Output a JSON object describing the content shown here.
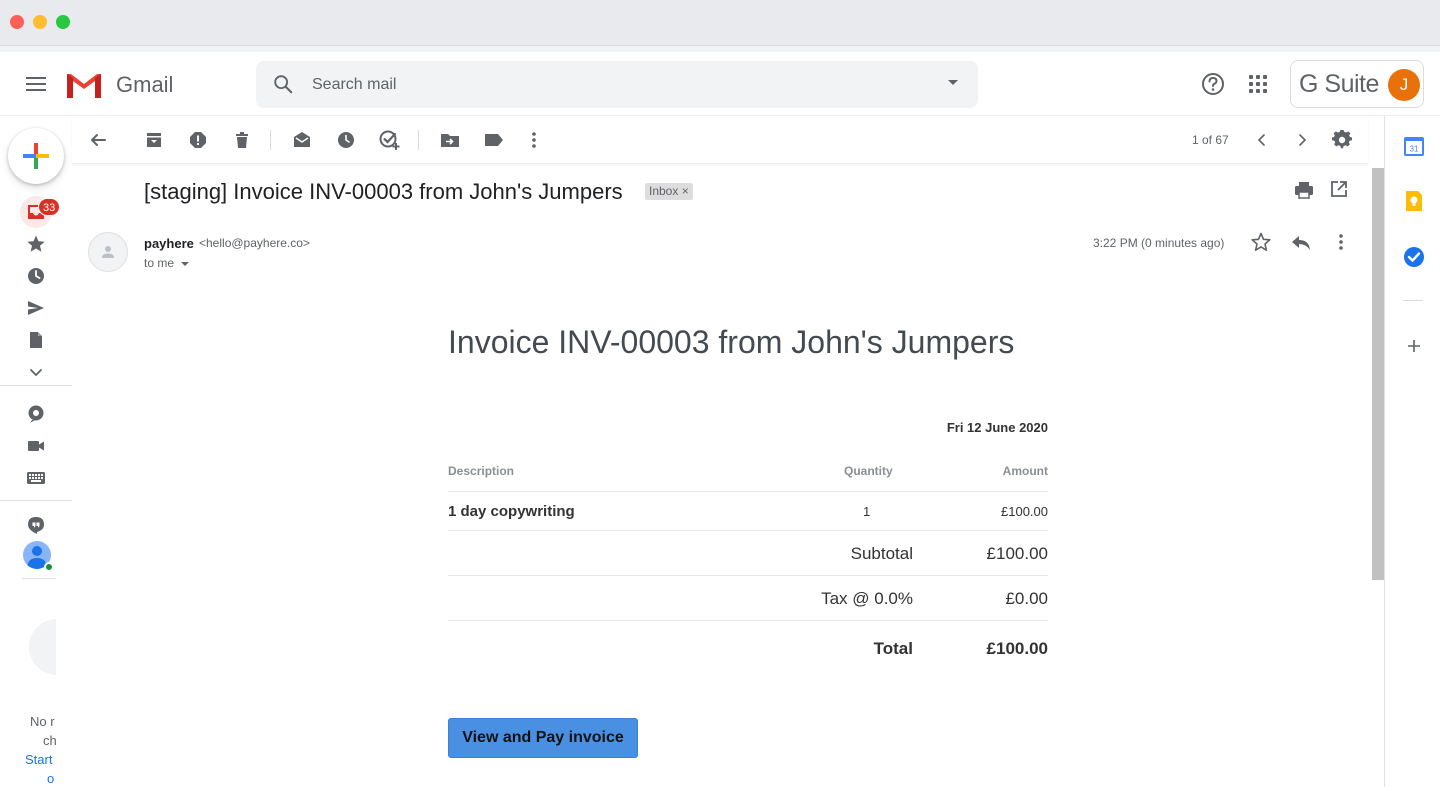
{
  "app": {
    "name": "Gmail"
  },
  "header": {
    "search_placeholder": "Search mail",
    "gsuite_label": "G Suite",
    "account_initial": "J"
  },
  "leftnav": {
    "inbox_badge": "33",
    "chat_empty_line1": "No r",
    "chat_empty_line2": "ch",
    "chat_start_line1": "Start",
    "chat_start_line2": "o"
  },
  "toolbar": {
    "pager": "1 of 67"
  },
  "message": {
    "subject": "[staging] Invoice INV-00003 from John's Jumpers",
    "label_chip": "Inbox ×",
    "sender_name": "payhere",
    "sender_email": "<hello@payhere.co>",
    "recipient": "to me",
    "time": "3:22 PM (0 minutes ago)"
  },
  "invoice": {
    "title": "Invoice INV-00003 from John's Jumpers",
    "date": "Fri 12 June 2020",
    "columns": [
      "Description",
      "Quantity",
      "Amount"
    ],
    "items": [
      {
        "description": "1 day copywriting",
        "quantity": "1",
        "amount": "£100.00"
      }
    ],
    "subtotal_label": "Subtotal",
    "subtotal": "£100.00",
    "tax_label": "Tax @ 0.0%",
    "tax": "£0.00",
    "total_label": "Total",
    "total": "£100.00",
    "pay_button": "View and Pay invoice"
  },
  "colors": {
    "gmail_red": "#ea4335",
    "accent_blue": "#4a90e2",
    "badge_red": "#d93025",
    "avatar_orange": "#e8710a"
  }
}
